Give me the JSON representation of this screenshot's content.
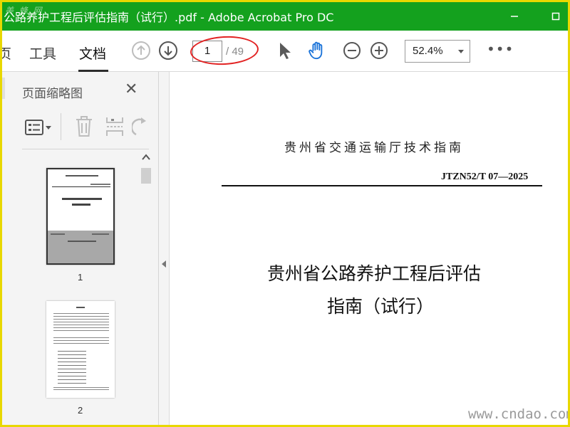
{
  "window": {
    "title": "公路养护工程后评估指南（试行）.pdf - Adobe Acrobat Pro DC",
    "watermark_top": "美 蜂 网",
    "minimize_icon": "minimize-icon",
    "maximize_icon": "maximize-icon"
  },
  "toolbar": {
    "tab_partial": "页",
    "tab_tools": "工具",
    "tab_document": "文档",
    "current_page": "1",
    "total_pages": "/ 49",
    "zoom": "52.4%",
    "more": "•••",
    "icons": [
      "arrow-up-circle-icon",
      "arrow-down-circle-icon",
      "pointer-icon",
      "hand-icon",
      "zoom-out-icon",
      "zoom-in-icon"
    ]
  },
  "sidebar": {
    "title": "页面缩略图",
    "close": "✕",
    "tool_icons": [
      "thumbnail-options-icon",
      "trash-icon",
      "insert-page-icon",
      "rotate-icon"
    ],
    "thumbnails": [
      {
        "label": "1"
      },
      {
        "label": "2"
      }
    ]
  },
  "document": {
    "header": "贵州省交通运输厅技术指南",
    "code": "JTZN52/T 07—2025",
    "title_line1": "贵州省公路养护工程后评估",
    "title_line2": "指南（试行）"
  },
  "watermark_bottom": "www.cndao.com",
  "colors": {
    "titlebar": "#14a11e",
    "frame": "#e8d800",
    "annotation": "#e22222"
  }
}
